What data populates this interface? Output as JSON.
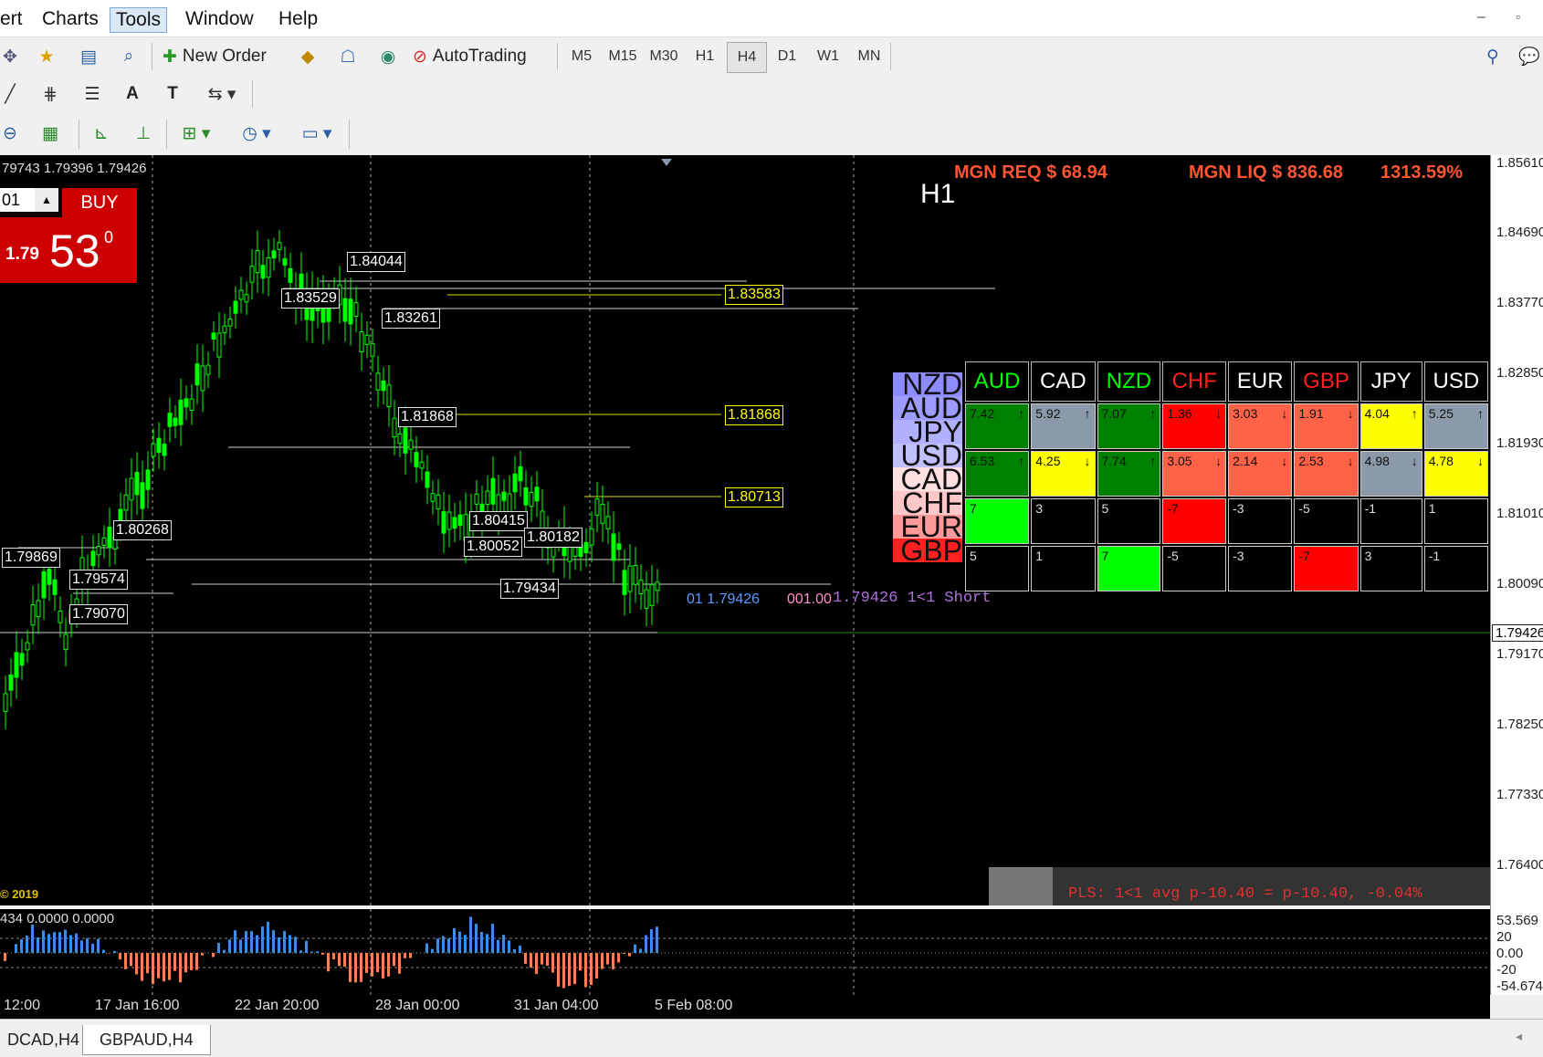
{
  "menu": {
    "items": [
      "ert",
      "Charts",
      "Tools",
      "Window",
      "Help"
    ],
    "active": "Tools"
  },
  "toolbar": {
    "new_order": "New Order",
    "autotrading": "AutoTrading",
    "timeframes": [
      "M5",
      "M15",
      "M30",
      "H1",
      "H4",
      "D1",
      "W1",
      "MN"
    ],
    "active_tf": "H4",
    "text_tool": "A",
    "text_label_tool": "T"
  },
  "chart": {
    "ohlc": "79743 1.79396 1.79426",
    "trade": {
      "lot": "01",
      "buy_label": "BUY",
      "price_small": "1.79",
      "price_big": "53",
      "price_sup": "0"
    },
    "margin_req": "MGN REQ $ 68.94",
    "margin_liq": "MGN LIQ $ 836.68",
    "margin_pct": "1313.59%",
    "copyright": "© 2019",
    "pls_text": "PLS: 1<1 avg p-10.40 = p-10.40, -0.04%",
    "line_labels": [
      {
        "text": "1.84044"
      },
      {
        "text": "1.83529"
      },
      {
        "text": "1.83261"
      },
      {
        "text": "1.81868"
      },
      {
        "text": "1.80415"
      },
      {
        "text": "1.80052"
      },
      {
        "text": "1.80182"
      },
      {
        "text": "1.80268"
      },
      {
        "text": "1.79869"
      },
      {
        "text": "1.79574"
      },
      {
        "text": "1.79070"
      },
      {
        "text": "1.79434"
      }
    ],
    "yellow_labels": [
      "1.83583",
      "1.81868",
      "1.80713"
    ],
    "order_label_blue": "01  1.79426",
    "order_label_pink": "001.00",
    "order_label_purple": "1.79426 1<1 Short"
  },
  "strength": {
    "title": "H1",
    "rank": [
      "NZD",
      "AUD",
      "JPY",
      "USD",
      "CAD",
      "CHF",
      "EUR",
      "GBP"
    ],
    "rank_colors": [
      "#8c8cff",
      "#9c9cff",
      "#b0b0ff",
      "#c0c0ff",
      "#ffe0e0",
      "#ffc8c8",
      "#ff9a9a",
      "#ff2020"
    ],
    "headers": [
      {
        "name": "AUD",
        "color": "#00ff00"
      },
      {
        "name": "CAD",
        "color": "#ffffff"
      },
      {
        "name": "NZD",
        "color": "#00ff00"
      },
      {
        "name": "CHF",
        "color": "#ff2020"
      },
      {
        "name": "EUR",
        "color": "#ffffff"
      },
      {
        "name": "GBP",
        "color": "#ff2020"
      },
      {
        "name": "JPY",
        "color": "#ffffff"
      },
      {
        "name": "USD",
        "color": "#ffffff"
      }
    ],
    "rows": [
      [
        {
          "v": "7.42",
          "a": "↑",
          "c": "#008000"
        },
        {
          "v": "5.92",
          "a": "↑",
          "c": "#8a9aa8"
        },
        {
          "v": "7.07",
          "a": "↑",
          "c": "#008000"
        },
        {
          "v": "1.36",
          "a": "↓",
          "c": "#ff0000"
        },
        {
          "v": "3.03",
          "a": "↓",
          "c": "#ff6347"
        },
        {
          "v": "1.91",
          "a": "↓",
          "c": "#ff6347"
        },
        {
          "v": "4.04",
          "a": "↑",
          "c": "#ffff00"
        },
        {
          "v": "5.25",
          "a": "↑",
          "c": "#8a9aa8"
        }
      ],
      [
        {
          "v": "6.53",
          "a": "↑",
          "c": "#008000"
        },
        {
          "v": "4.25",
          "a": "↓",
          "c": "#ffff00"
        },
        {
          "v": "7.74",
          "a": "↑",
          "c": "#008000"
        },
        {
          "v": "3.05",
          "a": "↓",
          "c": "#ff6347"
        },
        {
          "v": "2.14",
          "a": "↓",
          "c": "#ff6347"
        },
        {
          "v": "2.53",
          "a": "↓",
          "c": "#ff6347"
        },
        {
          "v": "4.98",
          "a": "↓",
          "c": "#8a9aa8"
        },
        {
          "v": "4.78",
          "a": "↓",
          "c": "#ffff00"
        }
      ],
      [
        {
          "v": "7",
          "a": "",
          "c": "#00ff00"
        },
        {
          "v": "3",
          "a": "",
          "c": "#000000"
        },
        {
          "v": "5",
          "a": "",
          "c": "#000000"
        },
        {
          "v": "-7",
          "a": "",
          "c": "#ff0000"
        },
        {
          "v": "-3",
          "a": "",
          "c": "#000000"
        },
        {
          "v": "-5",
          "a": "",
          "c": "#000000"
        },
        {
          "v": "-1",
          "a": "",
          "c": "#000000"
        },
        {
          "v": "1",
          "a": "",
          "c": "#000000"
        }
      ],
      [
        {
          "v": "5",
          "a": "",
          "c": "#000000"
        },
        {
          "v": "1",
          "a": "",
          "c": "#000000"
        },
        {
          "v": "7",
          "a": "",
          "c": "#00ff00"
        },
        {
          "v": "-5",
          "a": "",
          "c": "#000000"
        },
        {
          "v": "-3",
          "a": "",
          "c": "#000000"
        },
        {
          "v": "-7",
          "a": "",
          "c": "#ff0000"
        },
        {
          "v": "3",
          "a": "",
          "c": "#000000"
        },
        {
          "v": "-1",
          "a": "",
          "c": "#000000"
        }
      ]
    ]
  },
  "indicator": {
    "values": "434 0.0000 0.0000",
    "levels": [
      "53.569",
      "20",
      "0.00",
      "-20",
      "-54.674"
    ]
  },
  "price_axis": [
    "1.85610",
    "1.84690",
    "1.83770",
    "1.82850",
    "1.81930",
    "1.81010",
    "1.80090",
    "1.79426",
    "1.79170",
    "1.78250",
    "1.77330",
    "1.76400"
  ],
  "current_price": "1.79426",
  "time_axis": [
    "12:00",
    "17 Jan 16:00",
    "22 Jan 20:00",
    "28 Jan 00:00",
    "31 Jan 04:00",
    "5 Feb 08:00"
  ],
  "tabs": [
    "DCAD,H4",
    "GBPAUD,H4"
  ],
  "active_tab": "GBPAUD,H4",
  "colors": {
    "candle": "#00ff00",
    "buy": "#cc0000",
    "bar_up": "#3a8ee6",
    "bar_down": "#ff7f50",
    "hline": "#d0d0d0",
    "yline": "#dcdc00"
  }
}
